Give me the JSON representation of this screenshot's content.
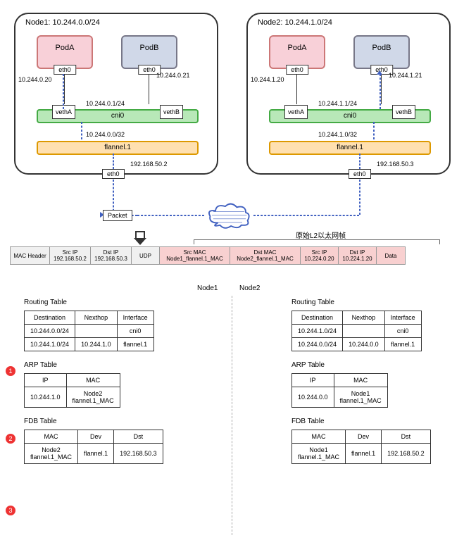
{
  "node1": {
    "title": "Node1: 10.244.0.0/24",
    "podA": "PodA",
    "podB": "PodB",
    "eth0": "eth0",
    "ipA": "10.244.0.20",
    "ipB": "10.244.0.21",
    "vethA": "vethA",
    "vethB": "vethB",
    "cni_ip": "10.244.0.1/24",
    "cni": "cni0",
    "flannel_sub": "10.244.0.0/32",
    "flannel": "flannel.1",
    "host_eth": "eth0",
    "host_ip": "192.168.50.2"
  },
  "node2": {
    "title": "Node2: 10.244.1.0/24",
    "podA": "PodA",
    "podB": "PodB",
    "eth0": "eth0",
    "ipA": "10.244.1.20",
    "ipB": "10.244.1.21",
    "vethA": "vethA",
    "vethB": "vethB",
    "cni_ip": "10.244.1.1/24",
    "cni": "cni0",
    "flannel_sub": "10.244.1.0/32",
    "flannel": "flannel.1",
    "host_eth": "eth0",
    "host_ip": "192.168.50.3"
  },
  "packet_label": "Packet",
  "l2_label": "原始L2以太网帧",
  "packet": {
    "mac_header": "MAC Header",
    "src_ip_h": "Src IP",
    "src_ip": "192.168.50.2",
    "dst_ip_h": "Dst IP",
    "dst_ip": "192.168.50.3",
    "udp": "UDP",
    "src_mac_h": "Src MAC",
    "src_mac": "Node1_flannel.1_MAC",
    "dst_mac_h": "Dst MAC",
    "dst_mac": "Node2_flannel.1_MAC",
    "src_ip2_h": "Src IP",
    "src_ip2": "10.224.0.20",
    "dst_ip2_h": "Dst IP",
    "dst_ip2": "10.224.1.20",
    "data": "Data"
  },
  "section_labels": {
    "node1": "Node1",
    "node2": "Node2",
    "routing": "Routing Table",
    "arp": "ARP Table",
    "fdb": "FDB Table"
  },
  "rt_headers": {
    "dest": "Destination",
    "next": "Nexthop",
    "iface": "Interface"
  },
  "arp_headers": {
    "ip": "IP",
    "mac": "MAC"
  },
  "fdb_headers": {
    "mac": "MAC",
    "dev": "Dev",
    "dst": "Dst"
  },
  "node1_rt": [
    {
      "dest": "10.244.0.0/24",
      "next": "",
      "iface": "cni0"
    },
    {
      "dest": "10.244.1.0/24",
      "next": "10.244.1.0",
      "iface": "flannel.1"
    }
  ],
  "node1_arp": [
    {
      "ip": "10.244.1.0",
      "mac": "Node2\nflannel.1_MAC"
    }
  ],
  "node1_fdb": [
    {
      "mac": "Node2\nflannel.1_MAC",
      "dev": "flannel.1",
      "dst": "192.168.50.3"
    }
  ],
  "node2_rt": [
    {
      "dest": "10.244.1.0/24",
      "next": "",
      "iface": "cni0"
    },
    {
      "dest": "10.244.0.0/24",
      "next": "10.244.0.0",
      "iface": "flannel.1"
    }
  ],
  "node2_arp": [
    {
      "ip": "10.244.0.0",
      "mac": "Node1\nflannel.1_MAC"
    }
  ],
  "node2_fdb": [
    {
      "mac": "Node1\nflannel.1_MAC",
      "dev": "flannel.1",
      "dst": "192.168.50.2"
    }
  ],
  "markers": {
    "m1": "1",
    "m2": "2",
    "m3": "3"
  },
  "chart_data": {
    "type": "network-diagram",
    "nodes": [
      {
        "name": "Node1",
        "cidr": "10.244.0.0/24",
        "host_ip": "192.168.50.2",
        "flannel_subnet": "10.244.0.0/32",
        "pods": [
          {
            "name": "PodA",
            "ip": "10.244.0.20"
          },
          {
            "name": "PodB",
            "ip": "10.244.0.21"
          }
        ],
        "cni0_ip": "10.244.0.1/24"
      },
      {
        "name": "Node2",
        "cidr": "10.244.1.0/24",
        "host_ip": "192.168.50.3",
        "flannel_subnet": "10.244.1.0/32",
        "pods": [
          {
            "name": "PodA",
            "ip": "10.244.1.20"
          },
          {
            "name": "PodB",
            "ip": "10.244.1.21"
          }
        ],
        "cni0_ip": "10.244.1.1/24"
      }
    ],
    "encapsulated_packet": {
      "outer": {
        "src_ip": "192.168.50.2",
        "dst_ip": "192.168.50.3",
        "proto": "UDP"
      },
      "inner": {
        "src_mac": "Node1_flannel.1_MAC",
        "dst_mac": "Node2_flannel.1_MAC",
        "src_ip": "10.224.0.20",
        "dst_ip": "10.224.1.20"
      }
    },
    "path": [
      "Node1.PodA",
      "Node1.vethA",
      "Node1.cni0",
      "Node1.flannel.1",
      "Node1.eth0",
      "network",
      "Node2.eth0",
      "Node2.flannel.1",
      "Node2.cni0",
      "Node2.vethB",
      "Node2.PodB"
    ]
  }
}
